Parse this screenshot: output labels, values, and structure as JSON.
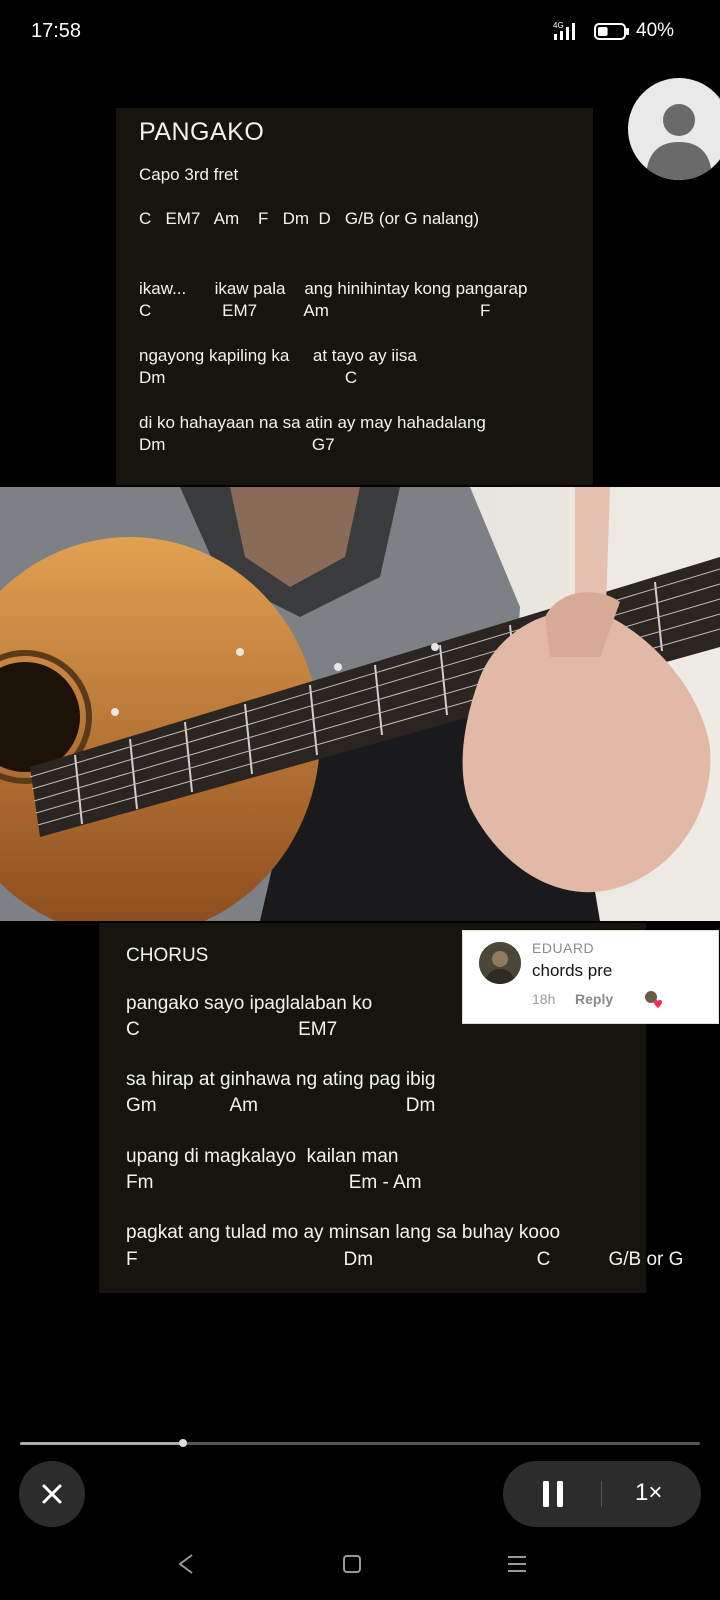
{
  "status_bar": {
    "time": "17:58",
    "network": "4G",
    "battery_percent": "40%",
    "battery_level": 0.4
  },
  "top_card": {
    "title": "PANGAKO",
    "capo": "Capo 3rd fret",
    "chords_list": "C   EM7   Am    F   Dm  D   G/B (or G nalang)",
    "lines": [
      {
        "lyric": "ikaw...      ikaw pala    ang hinihintay kong pangarap",
        "chords": "C               EM7          Am                                F"
      },
      {
        "lyric": "ngayong kapiling ka     at tayo ay iisa",
        "chords": "Dm                                      C"
      },
      {
        "lyric": "di ko hahayaan na sa atin ay may hahadalang",
        "chords": "Dm                               G7"
      }
    ]
  },
  "chorus_card": {
    "title": "CHORUS",
    "lines": [
      {
        "lyric": "pangako sayo ipaglalaban ko",
        "chords": "C                              EM7"
      },
      {
        "lyric": "sa hirap at ginhawa ng ating pag ibig",
        "chords": "Gm              Am                            Dm"
      },
      {
        "lyric": "upang di magkalayo  kailan man",
        "chords": "Fm                                     Em - Am"
      },
      {
        "lyric": "pagkat ang tulad mo ay minsan lang sa buhay kooo",
        "chords": "F                                       Dm                               C           G/B or G"
      }
    ]
  },
  "comment": {
    "author": "EDUARD",
    "text": "chords pre",
    "time": "18h",
    "reply_label": "Reply"
  },
  "player": {
    "progress": 0.24,
    "speed_label": "1×"
  },
  "icons": {
    "close": "close-icon",
    "pause": "pause-icon",
    "back": "back-icon",
    "home": "home-icon",
    "recents": "recents-icon"
  }
}
